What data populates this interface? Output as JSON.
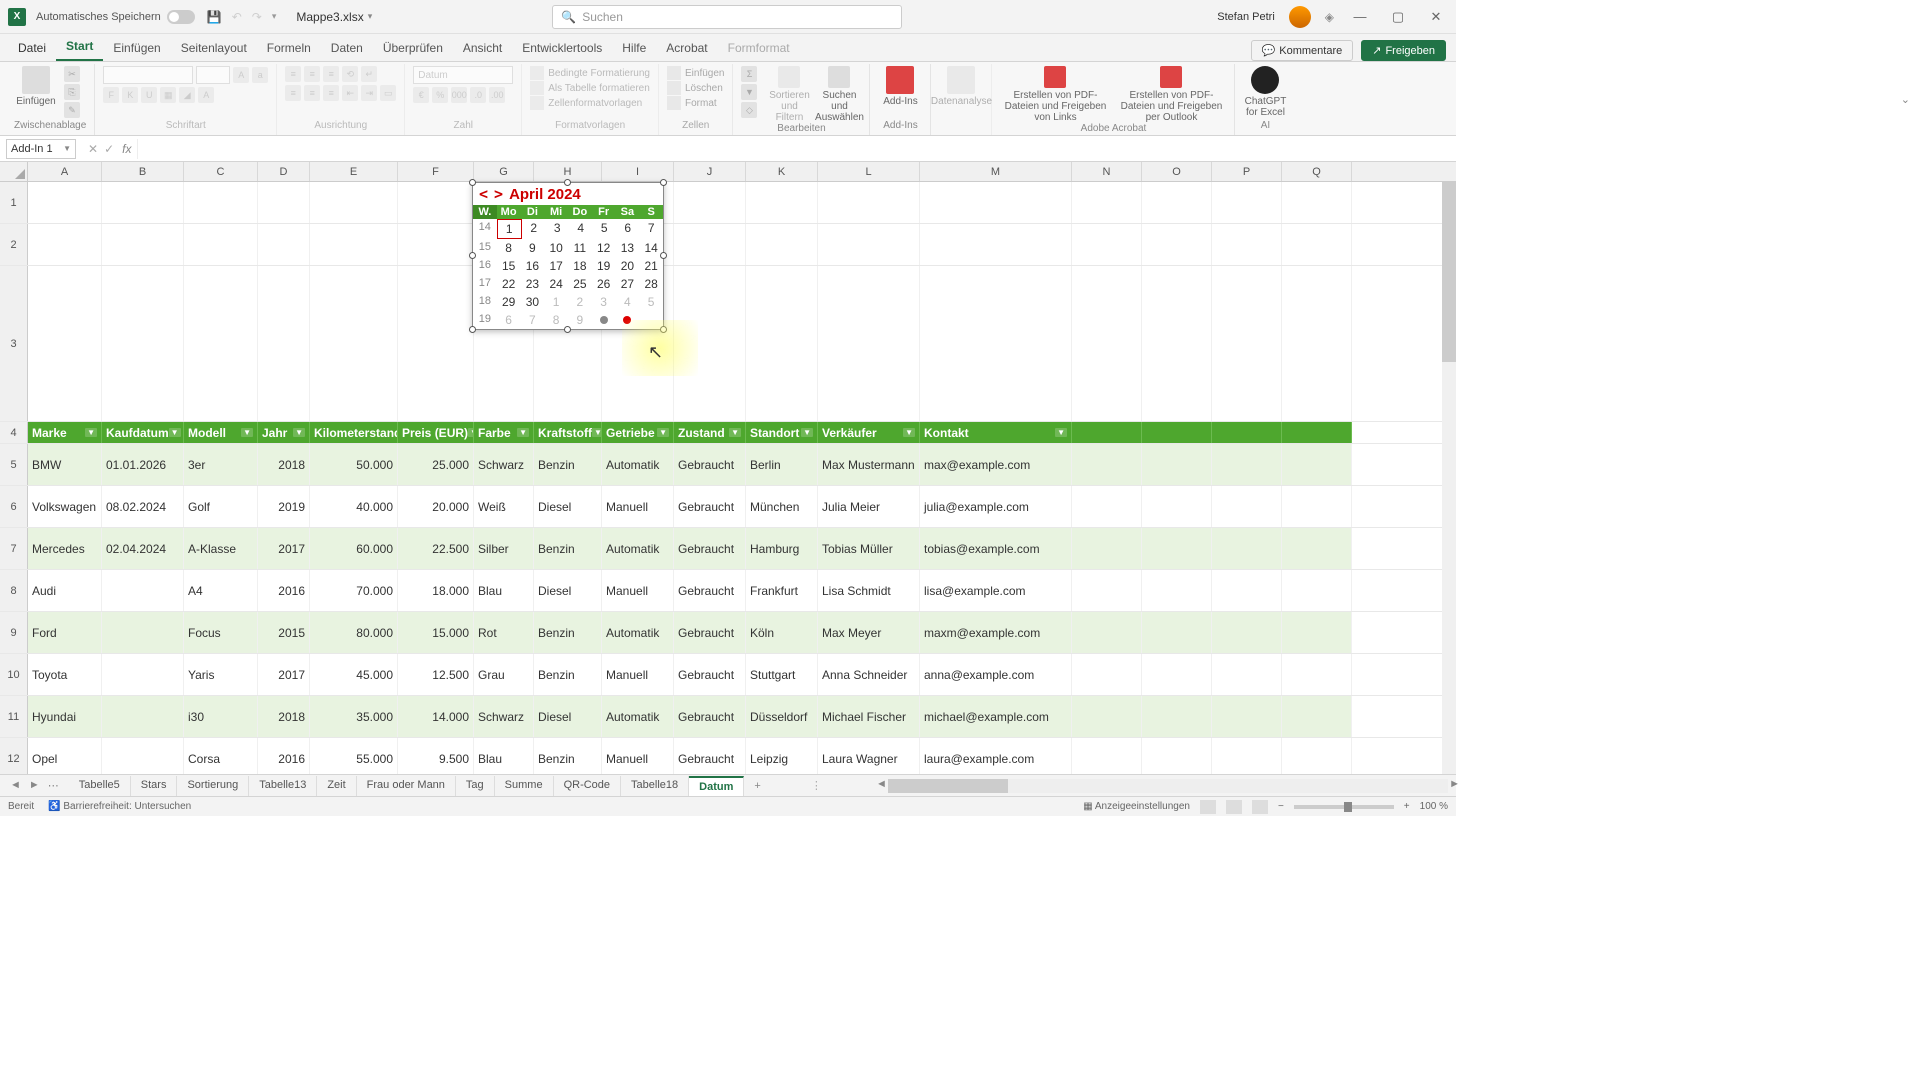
{
  "titlebar": {
    "auto_save": "Automatisches Speichern",
    "filename": "Mappe3.xlsx",
    "search_placeholder": "Suchen",
    "user": "Stefan Petri"
  },
  "ribbon_tabs": [
    "Datei",
    "Start",
    "Einfügen",
    "Seitenlayout",
    "Formeln",
    "Daten",
    "Überprüfen",
    "Ansicht",
    "Entwicklertools",
    "Hilfe",
    "Acrobat",
    "Formformat"
  ],
  "ribbon_right": {
    "comments": "Kommentare",
    "share": "Freigeben"
  },
  "ribbon_groups": {
    "clipboard": {
      "label": "Zwischenablage",
      "paste": "Einfügen"
    },
    "font": {
      "label": "Schriftart"
    },
    "align": {
      "label": "Ausrichtung"
    },
    "number": {
      "label": "Zahl",
      "format": "Datum"
    },
    "styles": {
      "label": "Formatvorlagen",
      "cond": "Bedingte Formatierung",
      "as_table": "Als Tabelle formatieren",
      "cell_styles": "Zellenformatvorlagen"
    },
    "cells": {
      "label": "Zellen",
      "insert": "Einfügen",
      "delete": "Löschen",
      "format": "Format"
    },
    "editing": {
      "label": "Bearbeiten",
      "sort": "Sortieren und Filtern",
      "find": "Suchen und Auswählen"
    },
    "addins": {
      "label": "Add-Ins",
      "btn": "Add-Ins"
    },
    "analysis": {
      "btn": "Datenanalyse"
    },
    "acrobat": {
      "label": "Adobe Acrobat",
      "btn1": "Erstellen von PDF-Dateien und Freigeben von Links",
      "btn2": "Erstellen von PDF-Dateien und Freigeben per Outlook"
    },
    "ai": {
      "label": "AI",
      "btn": "ChatGPT for Excel"
    }
  },
  "namebox": "Add-In 1",
  "columns": [
    "A",
    "B",
    "C",
    "D",
    "E",
    "F",
    "G",
    "H",
    "I",
    "J",
    "K",
    "L",
    "M",
    "N",
    "O",
    "P",
    "Q"
  ],
  "row_heights": {
    "r1": 42,
    "r2": 42,
    "r3": 156,
    "data": 42
  },
  "table": {
    "headers": [
      "Marke",
      "Kaufdatum",
      "Modell",
      "Jahr",
      "Kilometerstand",
      "Preis (EUR)",
      "Farbe",
      "Kraftstoff",
      "Getriebe",
      "Zustand",
      "Standort",
      "Verkäufer",
      "Kontakt"
    ],
    "rows": [
      [
        "BMW",
        "01.01.2026",
        "3er",
        "2018",
        "50.000",
        "25.000",
        "Schwarz",
        "Benzin",
        "Automatik",
        "Gebraucht",
        "Berlin",
        "Max Mustermann",
        "max@example.com"
      ],
      [
        "Volkswagen",
        "08.02.2024",
        "Golf",
        "2019",
        "40.000",
        "20.000",
        "Weiß",
        "Diesel",
        "Manuell",
        "Gebraucht",
        "München",
        "Julia Meier",
        "julia@example.com"
      ],
      [
        "Mercedes",
        "02.04.2024",
        "A-Klasse",
        "2017",
        "60.000",
        "22.500",
        "Silber",
        "Benzin",
        "Automatik",
        "Gebraucht",
        "Hamburg",
        "Tobias Müller",
        "tobias@example.com"
      ],
      [
        "Audi",
        "",
        "A4",
        "2016",
        "70.000",
        "18.000",
        "Blau",
        "Diesel",
        "Manuell",
        "Gebraucht",
        "Frankfurt",
        "Lisa Schmidt",
        "lisa@example.com"
      ],
      [
        "Ford",
        "",
        "Focus",
        "2015",
        "80.000",
        "15.000",
        "Rot",
        "Benzin",
        "Automatik",
        "Gebraucht",
        "Köln",
        "Max Meyer",
        "maxm@example.com"
      ],
      [
        "Toyota",
        "",
        "Yaris",
        "2017",
        "45.000",
        "12.500",
        "Grau",
        "Benzin",
        "Manuell",
        "Gebraucht",
        "Stuttgart",
        "Anna Schneider",
        "anna@example.com"
      ],
      [
        "Hyundai",
        "",
        "i30",
        "2018",
        "35.000",
        "14.000",
        "Schwarz",
        "Diesel",
        "Automatik",
        "Gebraucht",
        "Düsseldorf",
        "Michael Fischer",
        "michael@example.com"
      ],
      [
        "Opel",
        "",
        "Corsa",
        "2016",
        "55.000",
        "9.500",
        "Blau",
        "Benzin",
        "Manuell",
        "Gebraucht",
        "Leipzig",
        "Laura Wagner",
        "laura@example.com"
      ]
    ]
  },
  "datepicker": {
    "title": "April 2024",
    "days": [
      "W.",
      "Mo",
      "Di",
      "Mi",
      "Do",
      "Fr",
      "Sa",
      "S"
    ],
    "weeks": [
      {
        "wk": "14",
        "d": [
          "1",
          "2",
          "3",
          "4",
          "5",
          "6",
          "7"
        ],
        "today": 0
      },
      {
        "wk": "15",
        "d": [
          "8",
          "9",
          "10",
          "11",
          "12",
          "13",
          "14"
        ]
      },
      {
        "wk": "16",
        "d": [
          "15",
          "16",
          "17",
          "18",
          "19",
          "20",
          "21"
        ]
      },
      {
        "wk": "17",
        "d": [
          "22",
          "23",
          "24",
          "25",
          "26",
          "27",
          "28"
        ]
      },
      {
        "wk": "18",
        "d": [
          "29",
          "30",
          "1",
          "2",
          "3",
          "4",
          "5"
        ],
        "muted_from": 2
      },
      {
        "wk": "19",
        "d": [
          "6",
          "7",
          "8",
          "9",
          "",
          "",
          ""
        ],
        "muted_from": 0,
        "dot": 4,
        "reddot": 5
      }
    ]
  },
  "sheets": [
    "Tabelle5",
    "Stars",
    "Sortierung",
    "Tabelle13",
    "Zeit",
    "Frau oder Mann",
    "Tag",
    "Summe",
    "QR-Code",
    "Tabelle18",
    "Datum"
  ],
  "active_sheet": "Datum",
  "statusbar": {
    "ready": "Bereit",
    "access": "Barrierefreiheit: Untersuchen",
    "display": "Anzeigeeinstellungen",
    "zoom": "100 %"
  }
}
